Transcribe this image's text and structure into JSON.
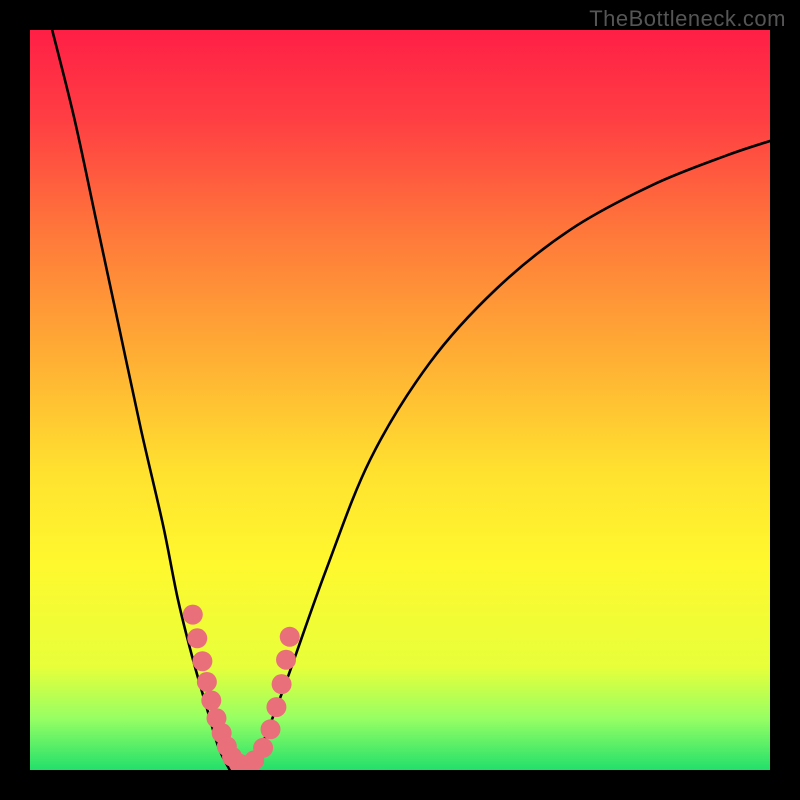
{
  "watermark": "TheBottleneck.com",
  "chart_data": {
    "type": "line",
    "title": "",
    "xlabel": "",
    "ylabel": "",
    "xlim": [
      0,
      100
    ],
    "ylim": [
      0,
      100
    ],
    "background_gradient": {
      "stops": [
        {
          "pct": 0,
          "color": "#ff1f46"
        },
        {
          "pct": 12,
          "color": "#ff3e43"
        },
        {
          "pct": 28,
          "color": "#ff7a3a"
        },
        {
          "pct": 45,
          "color": "#ffb134"
        },
        {
          "pct": 60,
          "color": "#ffe22f"
        },
        {
          "pct": 72,
          "color": "#fff82e"
        },
        {
          "pct": 86,
          "color": "#e7ff3a"
        },
        {
          "pct": 93,
          "color": "#97ff63"
        },
        {
          "pct": 100,
          "color": "#22e06b"
        }
      ]
    },
    "series": [
      {
        "name": "left-arm",
        "type": "line",
        "color": "#000000",
        "x": [
          3,
          6,
          9,
          12,
          15,
          18,
          20,
          22,
          24,
          25.5,
          27
        ],
        "y": [
          100,
          88,
          74,
          60,
          46,
          33,
          23,
          15,
          8,
          3,
          0
        ]
      },
      {
        "name": "right-arm",
        "type": "line",
        "color": "#000000",
        "x": [
          30,
          32,
          35,
          40,
          46,
          54,
          63,
          73,
          84,
          94,
          100
        ],
        "y": [
          0,
          5,
          13,
          27,
          42,
          55,
          65,
          73,
          79,
          83,
          85
        ]
      },
      {
        "name": "marker-cluster",
        "type": "scatter",
        "color": "#e96f7a",
        "x": [
          22.0,
          22.6,
          23.3,
          23.9,
          24.5,
          25.2,
          25.9,
          26.6,
          27.3,
          28.2,
          29.2,
          30.3,
          31.5,
          32.5,
          33.3,
          34.0,
          34.6,
          35.1
        ],
        "y": [
          21.0,
          17.8,
          14.7,
          11.9,
          9.4,
          7.0,
          5.0,
          3.2,
          1.8,
          0.9,
          0.6,
          1.3,
          3.0,
          5.5,
          8.5,
          11.6,
          14.9,
          18.0
        ]
      }
    ]
  }
}
